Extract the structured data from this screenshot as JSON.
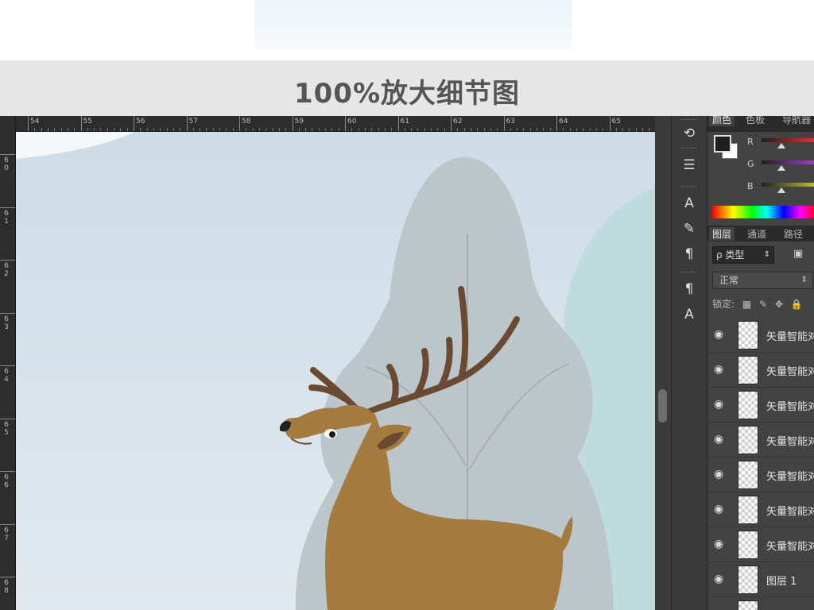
{
  "banner": {
    "title": "100%放大细节图"
  },
  "ruler": {
    "top_labels": [
      "54",
      "55",
      "56",
      "57",
      "58",
      "59",
      "60",
      "61",
      "62",
      "63",
      "64",
      "65"
    ],
    "left_labels": [
      "6 0",
      "6 1",
      "6 2",
      "6 3",
      "6 4",
      "6 5",
      "6 6",
      "6 7",
      "6 8"
    ]
  },
  "tools": [
    {
      "name": "history-icon",
      "glyph": "⟲"
    },
    {
      "name": "actions-icon",
      "glyph": "☰"
    },
    {
      "name": "character-icon",
      "glyph": "A"
    },
    {
      "name": "brush-icon",
      "glyph": "✎"
    },
    {
      "name": "paragraph-icon",
      "glyph": "¶"
    },
    {
      "name": "paragraph-style-icon",
      "glyph": "¶"
    },
    {
      "name": "character-style-icon",
      "glyph": "A"
    }
  ],
  "color_panel": {
    "tabs": [
      "颜色",
      "色板",
      "导航器"
    ],
    "channels": [
      "R",
      "G",
      "B"
    ],
    "knob_levels": [
      0.35,
      0.35,
      0.35
    ]
  },
  "layers_panel": {
    "tabs": [
      "图层",
      "通道",
      "路径"
    ],
    "filter_label": "ρ 类型",
    "blend_mode": "正常",
    "lock_label": "锁定:",
    "layers": [
      {
        "name": "矢量智能对象"
      },
      {
        "name": "矢量智能对象"
      },
      {
        "name": "矢量智能对象"
      },
      {
        "name": "矢量智能对象"
      },
      {
        "name": "矢量智能对象"
      },
      {
        "name": "矢量智能对象"
      },
      {
        "name": "矢量智能对象"
      },
      {
        "name": "图层 1"
      },
      {
        "name": ""
      }
    ]
  },
  "colors": {
    "sky_top": "#cfdde7",
    "sky_bottom": "#dfe8ef",
    "tree_gray": "#bcc5c9",
    "tree_teal": "#bfdcdc",
    "deer_body": "#a47a3e",
    "antler": "#6b4a33"
  }
}
